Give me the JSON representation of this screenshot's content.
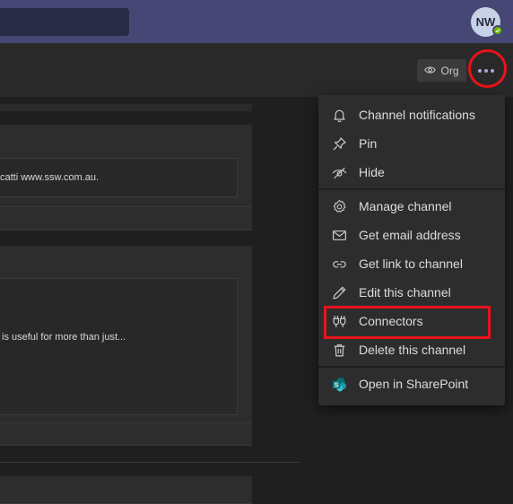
{
  "user": {
    "initials": "NW",
    "status_color": "#6bb700"
  },
  "header": {
    "org_label": "Org"
  },
  "posts": [
    {
      "text": "catti www.ssw.com.au."
    },
    {
      "text": "is useful for more than just..."
    }
  ],
  "menu": {
    "items": [
      {
        "label": "Channel notifications",
        "icon": "bell-icon"
      },
      {
        "label": "Pin",
        "icon": "pin-icon"
      },
      {
        "label": "Hide",
        "icon": "eye-off-icon"
      },
      {
        "label": "Manage channel",
        "icon": "gear-icon"
      },
      {
        "label": "Get email address",
        "icon": "envelope-icon"
      },
      {
        "label": "Get link to channel",
        "icon": "link-icon"
      },
      {
        "label": "Edit this channel",
        "icon": "pencil-icon"
      },
      {
        "label": "Connectors",
        "icon": "plug-icon"
      },
      {
        "label": "Delete this channel",
        "icon": "trash-icon"
      },
      {
        "label": "Open in SharePoint",
        "icon": "sharepoint-icon"
      }
    ]
  },
  "colors": {
    "accent": "#464775",
    "highlight": "#e8131a",
    "menu_bg": "#2d2d2d"
  }
}
